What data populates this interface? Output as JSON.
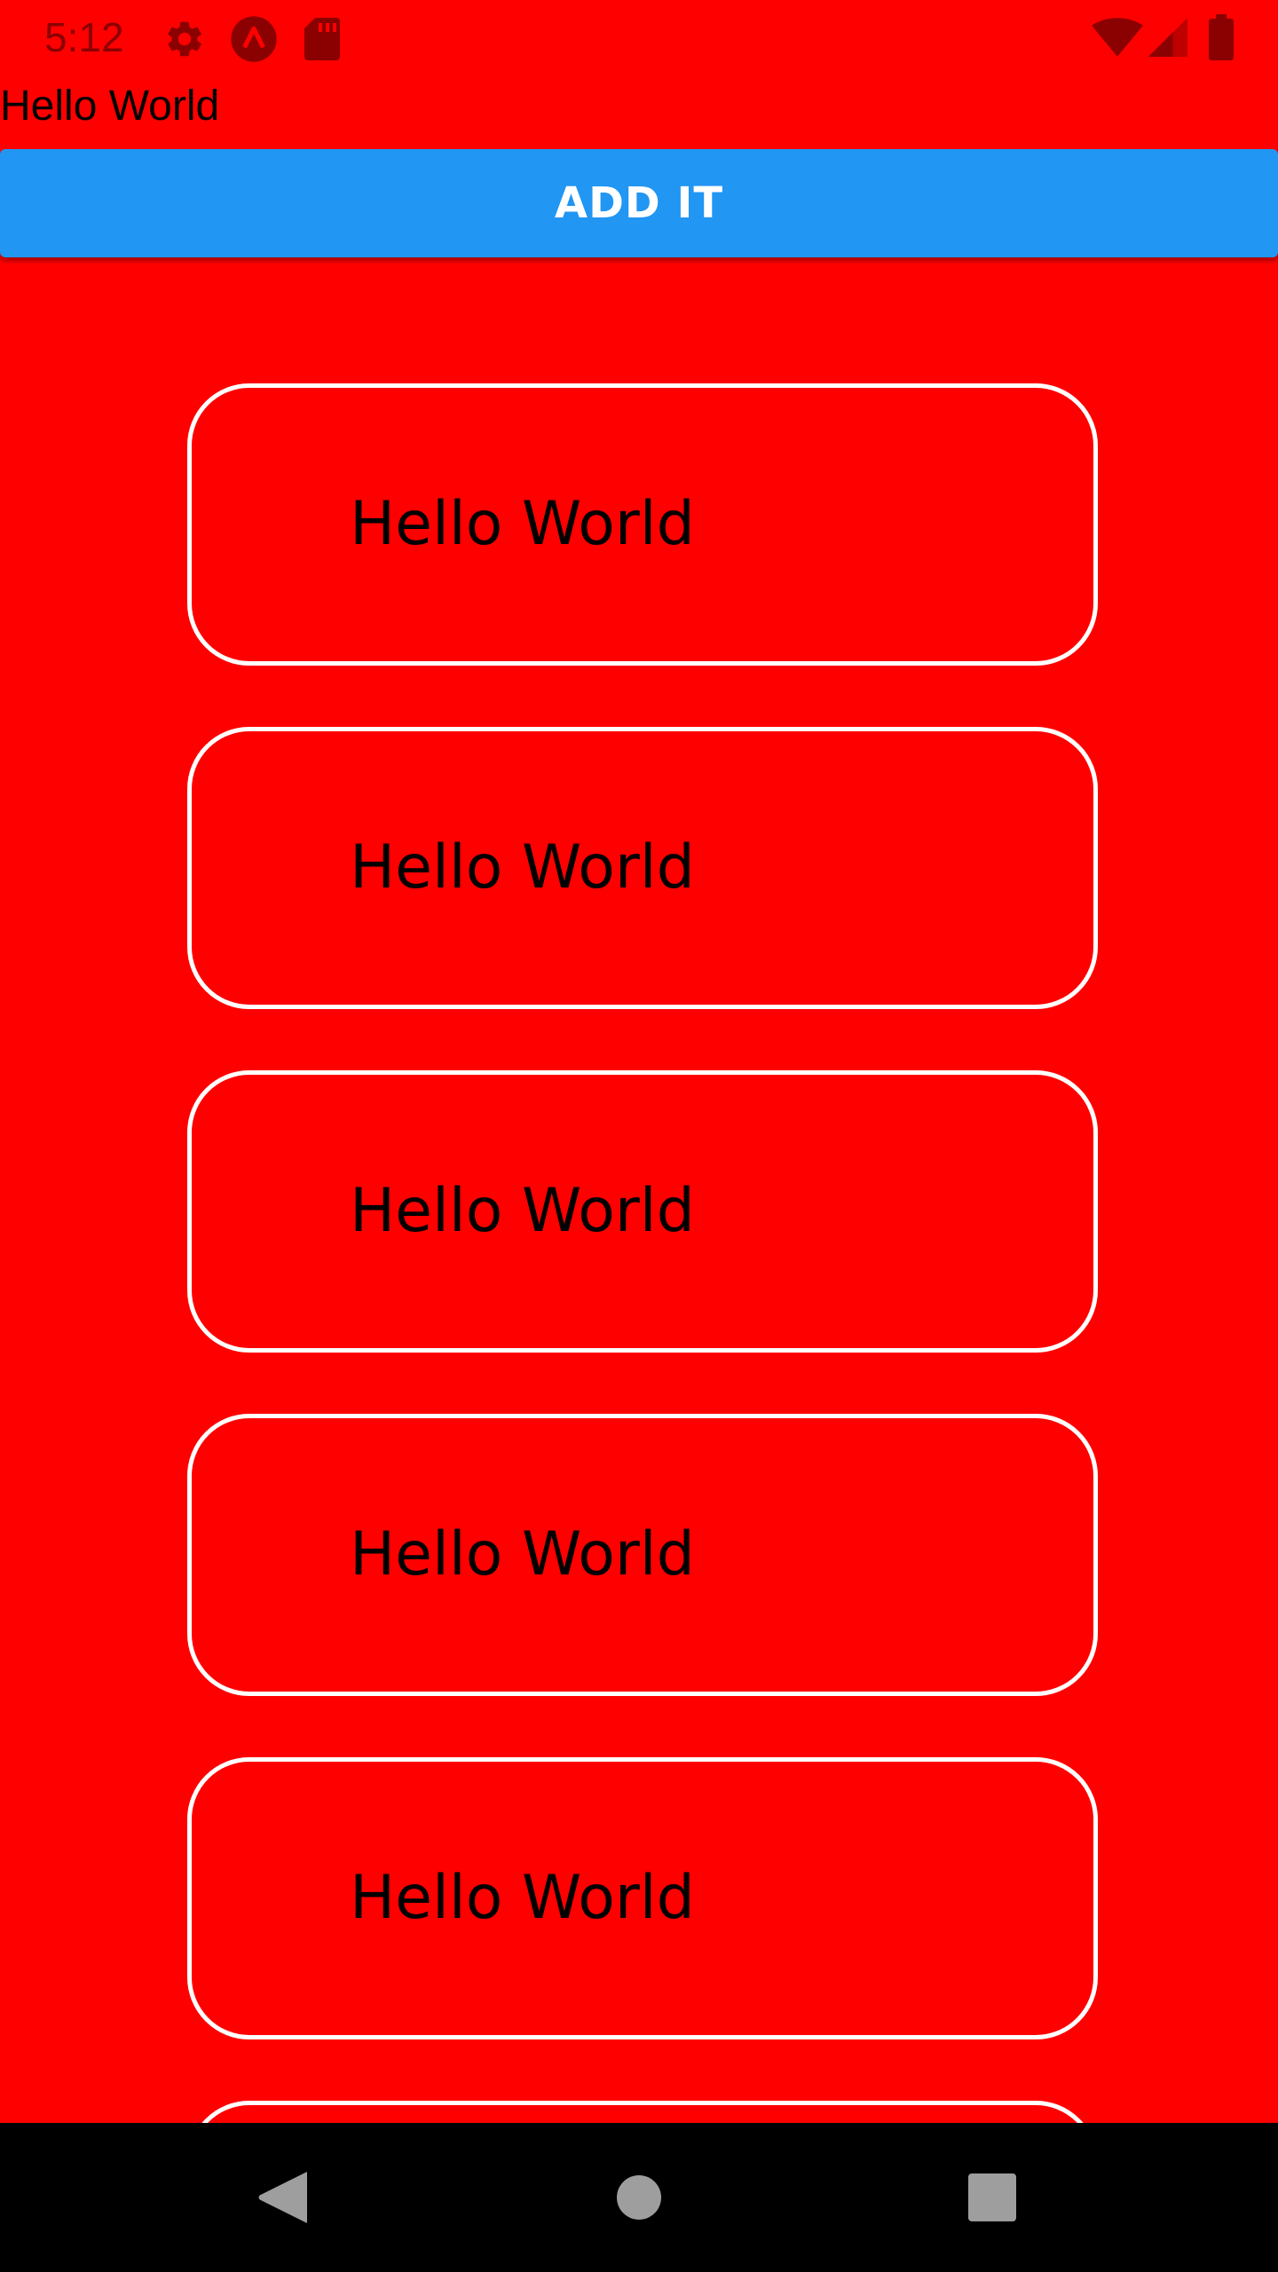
{
  "status_bar": {
    "time": "5:12",
    "left_icons": [
      "settings-icon",
      "app-icon",
      "sd-card-icon"
    ],
    "right_icons": [
      "wifi-icon",
      "cellular-signal-icon",
      "battery-icon"
    ]
  },
  "header": {
    "title": "Hello World"
  },
  "add_button": {
    "label": "ADD IT",
    "color": "#2196F3"
  },
  "list": {
    "items": [
      {
        "label": "Hello World"
      },
      {
        "label": "Hello World"
      },
      {
        "label": "Hello World"
      },
      {
        "label": "Hello World"
      },
      {
        "label": "Hello World"
      },
      {
        "label": ""
      }
    ]
  },
  "nav_bar": {
    "buttons": [
      "back-icon",
      "home-icon",
      "recents-icon"
    ]
  },
  "colors": {
    "background": "#FF0000",
    "card_border": "#FFFFFF",
    "nav_background": "#000000",
    "status_icon": "#8B0000"
  }
}
